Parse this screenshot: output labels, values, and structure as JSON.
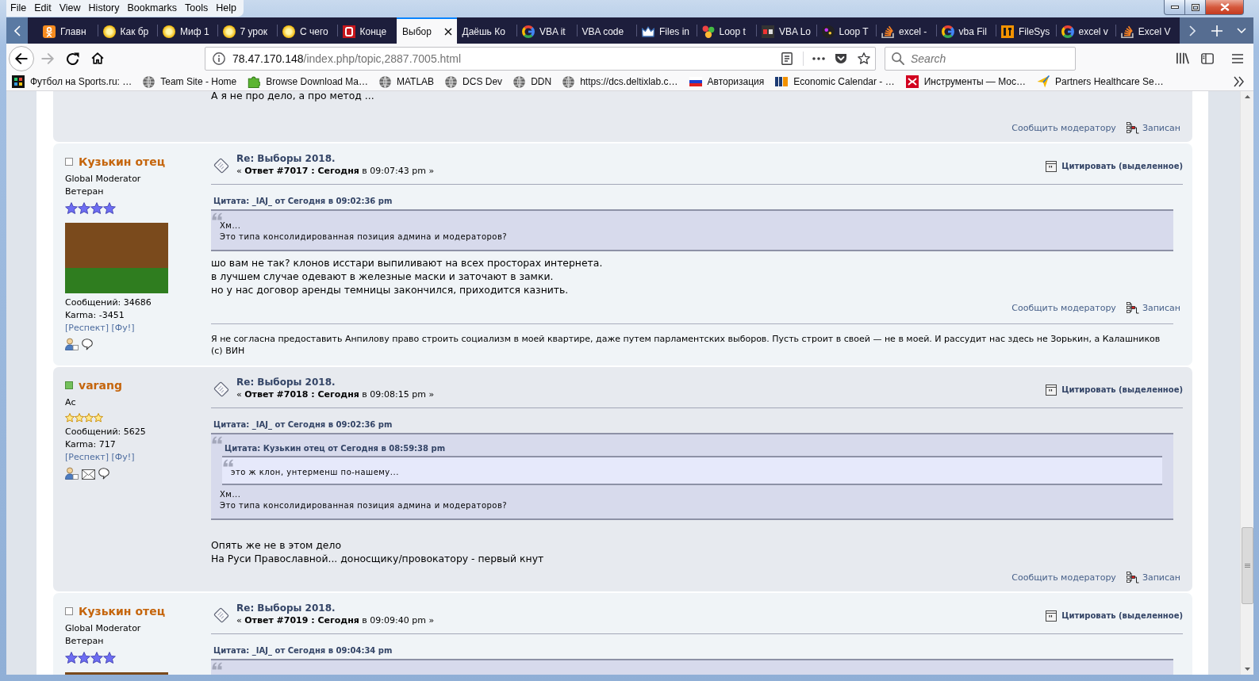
{
  "menu": [
    "File",
    "Edit",
    "View",
    "History",
    "Bookmarks",
    "Tools",
    "Help"
  ],
  "tabs": [
    {
      "label": "Главн",
      "kind": "ok",
      "selected": false
    },
    {
      "label": "Как бр",
      "kind": "sun",
      "selected": false
    },
    {
      "label": "Миф 1",
      "kind": "sun",
      "selected": false
    },
    {
      "label": "7 урок",
      "kind": "sun",
      "selected": false
    },
    {
      "label": "С чего",
      "kind": "sun",
      "selected": false
    },
    {
      "label": "Конце",
      "kind": "b",
      "selected": false
    },
    {
      "label": "Выбор",
      "kind": "plain",
      "selected": true
    },
    {
      "label": "Даёшь Ко",
      "kind": "plain",
      "selected": false
    },
    {
      "label": "VBA it",
      "kind": "google",
      "selected": false
    },
    {
      "label": "VBA code",
      "kind": "plain",
      "selected": false
    },
    {
      "label": "Files in",
      "kind": "crown",
      "selected": false
    },
    {
      "label": "Loop t",
      "kind": "leaf",
      "selected": false
    },
    {
      "label": "VBA Lo",
      "kind": "rw",
      "selected": false
    },
    {
      "label": "Loop T",
      "kind": "dark",
      "selected": false
    },
    {
      "label": "excel -",
      "kind": "stack",
      "selected": false
    },
    {
      "label": "vba Fil",
      "kind": "google",
      "selected": false
    },
    {
      "label": "FileSys",
      "kind": "et",
      "selected": false
    },
    {
      "label": "excel v",
      "kind": "google",
      "selected": false
    },
    {
      "label": "Excel V",
      "kind": "stack",
      "selected": false
    }
  ],
  "toolbar": {
    "forward_disabled": true,
    "url_host": "78.47.170.148",
    "url_path": "/index.php/topic,2887.7005.html",
    "search": {
      "placeholder": "Search"
    }
  },
  "bookmarks": [
    {
      "label": "Футбол на Sports.ru: …",
      "kind": "sports"
    },
    {
      "label": "Team Site - Home",
      "kind": "globe"
    },
    {
      "label": "Browse Download Ma…",
      "kind": "puzzle"
    },
    {
      "label": "MATLAB",
      "kind": "globe"
    },
    {
      "label": "DCS Dev",
      "kind": "globe"
    },
    {
      "label": "DDN",
      "kind": "globe"
    },
    {
      "label": "https://dcs.deltixlab.c…",
      "kind": "globe"
    },
    {
      "label": "Авторизация",
      "kind": "flag"
    },
    {
      "label": "Economic Calendar - …",
      "kind": "fxs"
    },
    {
      "label": "Инструменты — Мос…",
      "kind": "red"
    },
    {
      "label": "Partners Healthcare Se…",
      "kind": "plane"
    }
  ],
  "posts": [
    {
      "body": [
        "А я не про дело, а про метод ..."
      ],
      "blank_line_after": true,
      "footer": {
        "report": "Сообщить модератору",
        "logged": "Записан"
      }
    },
    {
      "poster": {
        "name": "Кузькин отец",
        "online": false,
        "kind": "moderator",
        "group": "Global Moderator",
        "rank": "Ветеран",
        "stars": 4,
        "avatar": true,
        "post_count": "Сообщений: 34686",
        "karma": "Karma: -3451",
        "respect": "[Респект]",
        "boo": "[Фу!]",
        "show_email": false
      },
      "title": "Re: Выборы 2018.",
      "meta": "« **Ответ #7017 : Сегодня** в 09:07:43 pm »",
      "quote_button": "Цитировать (выделенное)",
      "quote": {
        "header": "Цитата: _IAJ_ от Сегодня в 09:02:36 pm",
        "lines": [
          "Хм...",
          "Это типа консолидированная позиция админа и модераторов?"
        ]
      },
      "blank_line_before": false,
      "body": [
        "шо вам не так? клонов исстари выпиливают на всех просторах интернета.",
        "в лучшем случае одевают в железные маски и заточают в замки.",
        "но у нас договор аренды темницы закончился, приходится казнить."
      ],
      "blank_line_after": false,
      "footer": {
        "report": "Сообщить модератору",
        "logged": "Записан"
      },
      "signature": "Я не согласна предоставить Анпилову право строить социализм в моей квартире, даже путем парламентских выборов. Пусть строит в своей — не в моей. И рассудит нас здесь не Зорькин, а Калашников (с) ВИН"
    },
    {
      "poster": {
        "name": "varang",
        "online": true,
        "kind": "member",
        "group": "Ас",
        "stars": 4,
        "post_count": "Сообщений: 5625",
        "karma": "Karma: 717",
        "respect": "[Респект]",
        "boo": "[Фу!]",
        "show_email": true
      },
      "title": "Re: Выборы 2018.",
      "meta": "« **Ответ #7018 : Сегодня** в 09:08:15 pm »",
      "quote_button": "Цитировать (выделенное)",
      "quote": {
        "header": "Цитата: _IAJ_ от Сегодня в 09:02:36 pm",
        "quote": {
          "header": "Цитата: Кузькин отец от Сегодня в 08:59:38 pm",
          "lines": [
            "это ж клон, унтерменш по-нашему..."
          ]
        },
        "lines": [
          "Хм...",
          "Это типа консолидированная позиция админа и модераторов?"
        ]
      },
      "blank_line_before": true,
      "body": [
        "Опять же не в этом дело",
        "На Руси Православной... доносщику/провокатору - первый кнут"
      ],
      "blank_line_after": false,
      "footer": {
        "report": "Сообщить модератору",
        "logged": "Записан"
      }
    },
    {
      "poster": {
        "name": "Кузькин отец",
        "online": false,
        "kind": "moderator",
        "group": "Global Moderator",
        "rank": "Ветеран",
        "stars": 4,
        "avatar": true
      },
      "title": "Re: Выборы 2018.",
      "meta": "« **Ответ #7019 : Сегодня** в 09:09:40 pm »",
      "quote_button": "Цитировать (выделенное)",
      "quote": {
        "header": "Цитата: _IAJ_ от Сегодня в 09:04:34 pm"
      }
    }
  ]
}
